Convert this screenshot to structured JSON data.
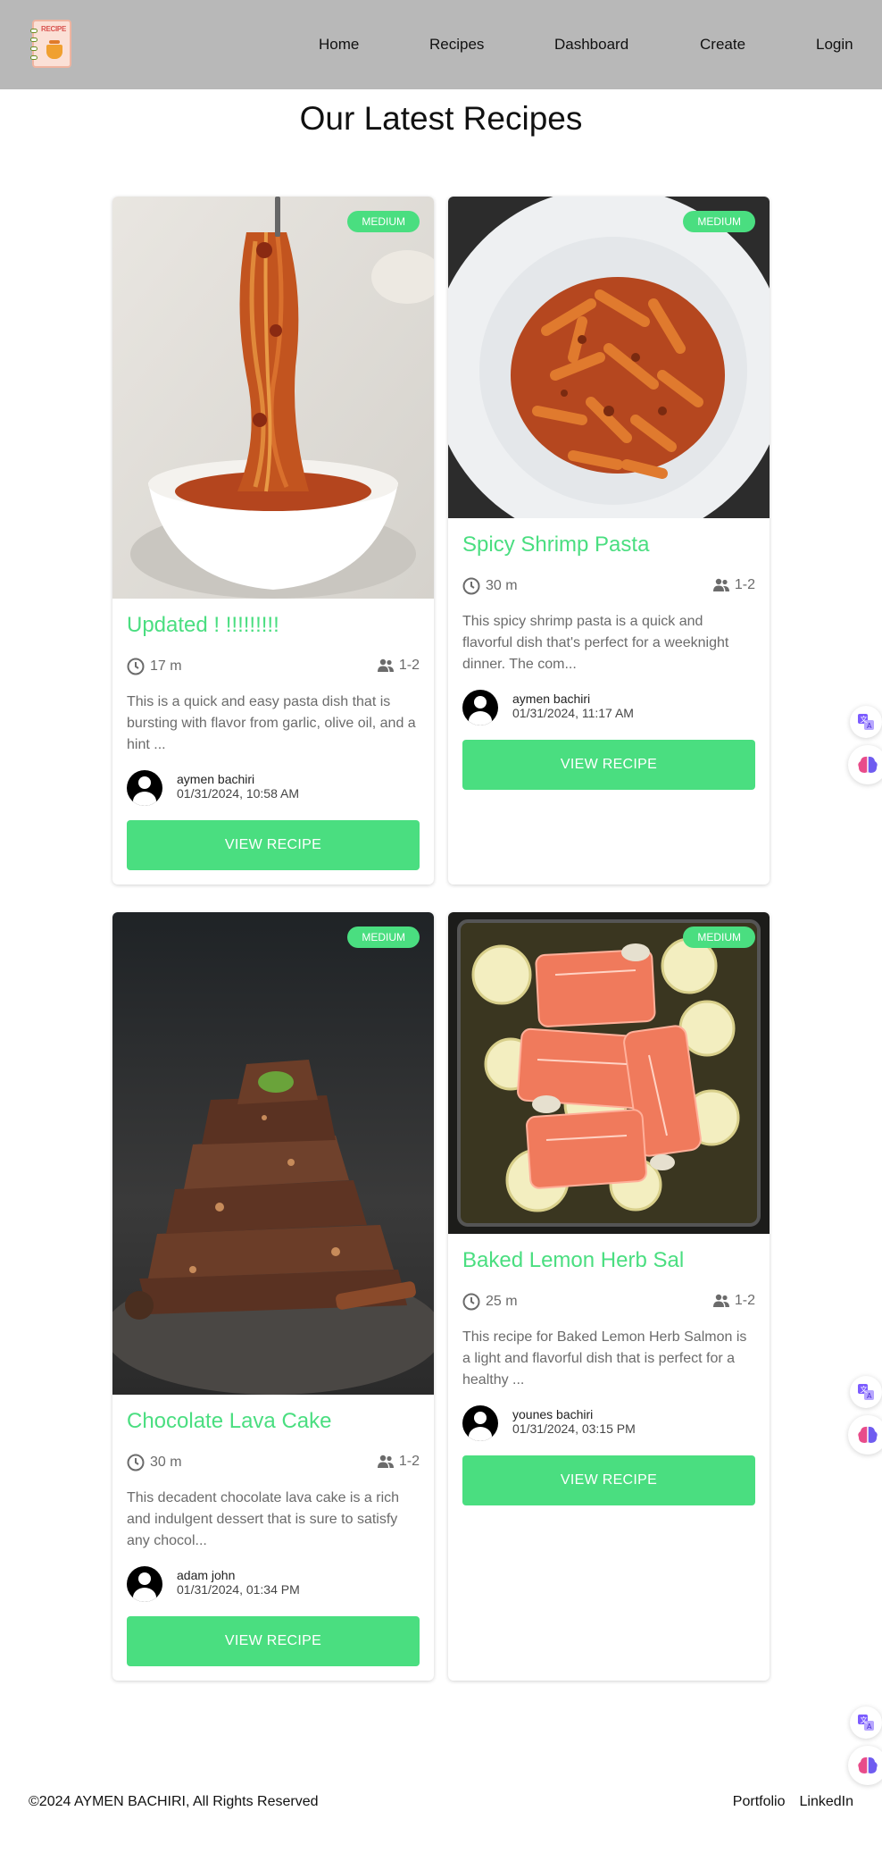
{
  "nav": {
    "logo_text": "RECIPE",
    "links": [
      "Home",
      "Recipes",
      "Dashboard",
      "Create",
      "Login"
    ]
  },
  "page_title": "Our Latest Recipes",
  "recipes": [
    {
      "difficulty": "MEDIUM",
      "title": "Updated ! !!!!!!!!!",
      "time": "17 m",
      "serves": "1-2",
      "description": "This is a quick and easy pasta dish that is bursting with flavor from garlic, olive oil, and a hint ...",
      "author": "aymen bachiri",
      "date": "01/31/2024, 10:58 AM",
      "button": "VIEW RECIPE"
    },
    {
      "difficulty": "MEDIUM",
      "title": "Spicy Shrimp Pasta",
      "time": "30 m",
      "serves": "1-2",
      "description": "This spicy shrimp pasta is a quick and flavorful dish that's perfect for a weeknight dinner. The com...",
      "author": "aymen bachiri",
      "date": "01/31/2024, 11:17 AM",
      "button": "VIEW RECIPE"
    },
    {
      "difficulty": "MEDIUM",
      "title": "Chocolate Lava Cake",
      "time": "30 m",
      "serves": "1-2",
      "description": "This decadent chocolate lava cake is a rich and indulgent dessert that is sure to satisfy any chocol...",
      "author": "adam john",
      "date": "01/31/2024, 01:34 PM",
      "button": "VIEW RECIPE"
    },
    {
      "difficulty": "MEDIUM",
      "title": "Baked Lemon Herb Sal",
      "time": "25 m",
      "serves": "1-2",
      "description": "This recipe for Baked Lemon Herb Salmon is a light and flavorful dish that is perfect for a healthy ...",
      "author": "younes bachiri",
      "date": "01/31/2024, 03:15 PM",
      "button": "VIEW RECIPE"
    }
  ],
  "footer": {
    "copyright": "©2024 AYMEN BACHIRI, All Rights Reserved",
    "links": [
      "Portfolio",
      "LinkedIn"
    ]
  },
  "colors": {
    "accent": "#4ade80",
    "navbar": "#b8b8b8",
    "muted_text": "#6b6b6b"
  },
  "icons": [
    "clock-icon",
    "people-icon",
    "user-avatar-icon",
    "translate-icon",
    "brain-icon"
  ]
}
